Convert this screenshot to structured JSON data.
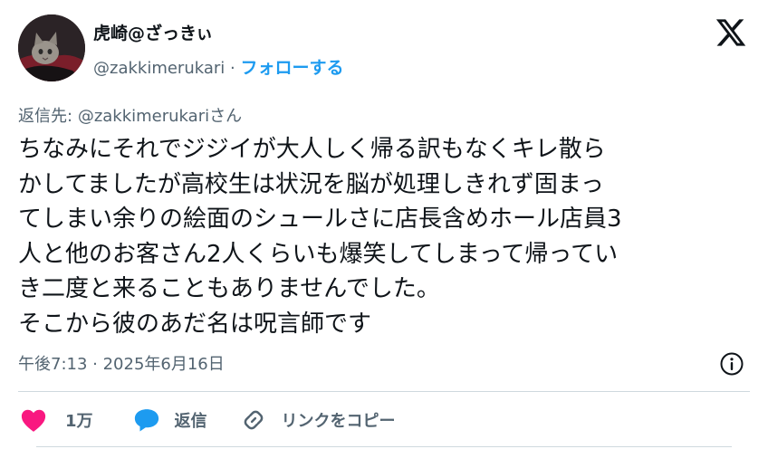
{
  "author": {
    "display_name": "虎崎@ざっきぃ",
    "handle": "@zakkimerukari",
    "separator": "·",
    "follow_label": "フォローする"
  },
  "reply_to": {
    "prefix": "返信先:",
    "mention": "@zakkimerukari",
    "suffix": "さん"
  },
  "tweet": {
    "lines": [
      "ちなみにそれでジジイが大人しく帰る訳もなくキレ散ら",
      "かしてましたが高校生は状況を脳が処理しきれず固まっ",
      "てしまい余りの絵面のシュールさに店長含めホール店員3",
      "人と他のお客さん2人くらいも爆笑してしまって帰ってい",
      "き二度と来ることもありませんでした。",
      "そこから彼のあだ名は呪言師です"
    ]
  },
  "meta": {
    "timestamp": "午後7:13 · 2025年6月16日"
  },
  "actions": {
    "like_count": "1万",
    "reply_label": "返信",
    "copy_label": "リンクをコピー"
  },
  "colors": {
    "accent": "#1d9bf0",
    "like": "#f91880",
    "secondary_text": "#536471"
  },
  "icons": [
    "x-logo-icon",
    "info-icon",
    "heart-icon",
    "reply-bubble-icon",
    "link-icon"
  ]
}
